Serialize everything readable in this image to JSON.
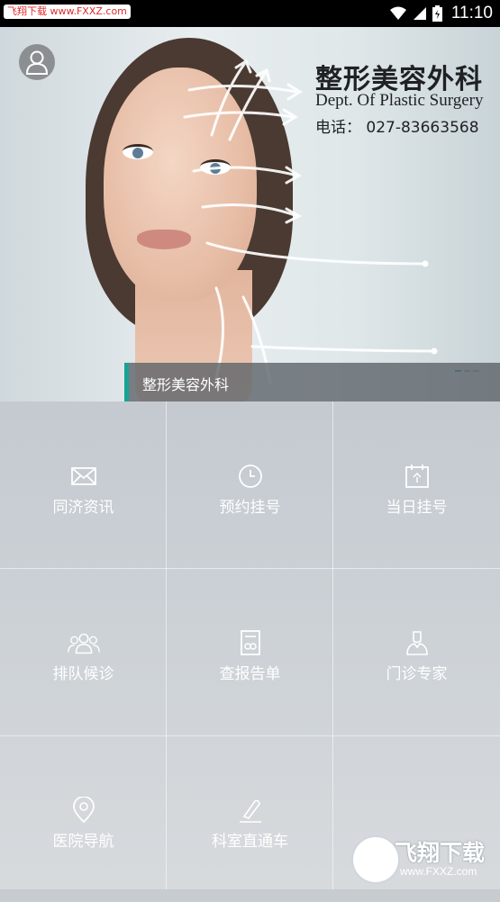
{
  "status_bar": {
    "watermark": "飞翔下载 www.FXXZ.com",
    "time": "11:10",
    "icons": [
      "wifi-icon",
      "signal-icon",
      "battery-icon"
    ]
  },
  "banner": {
    "title_cn": "整形美容外科",
    "title_en": "Dept. Of  Plastic Surgery",
    "phone": "电话：  027-83663568",
    "caption": "整形美容外科",
    "pager": {
      "count": 3,
      "active": 0
    }
  },
  "menu": [
    {
      "label": "同济资讯",
      "icon": "mail-icon"
    },
    {
      "label": "预约挂号",
      "icon": "clock-icon"
    },
    {
      "label": "当日挂号",
      "icon": "calendar-icon"
    },
    {
      "label": "排队候诊",
      "icon": "people-icon"
    },
    {
      "label": "查报告单",
      "icon": "report-icon"
    },
    {
      "label": "门诊专家",
      "icon": "doctor-icon"
    },
    {
      "label": "医院导航",
      "icon": "location-icon"
    },
    {
      "label": "科室直通车",
      "icon": "pen-icon"
    }
  ],
  "watermark_logo": {
    "text": "飞翔下载",
    "url": "www.FXXZ.com"
  },
  "colors": {
    "accent": "#1aa394",
    "label": "#ffffff"
  }
}
